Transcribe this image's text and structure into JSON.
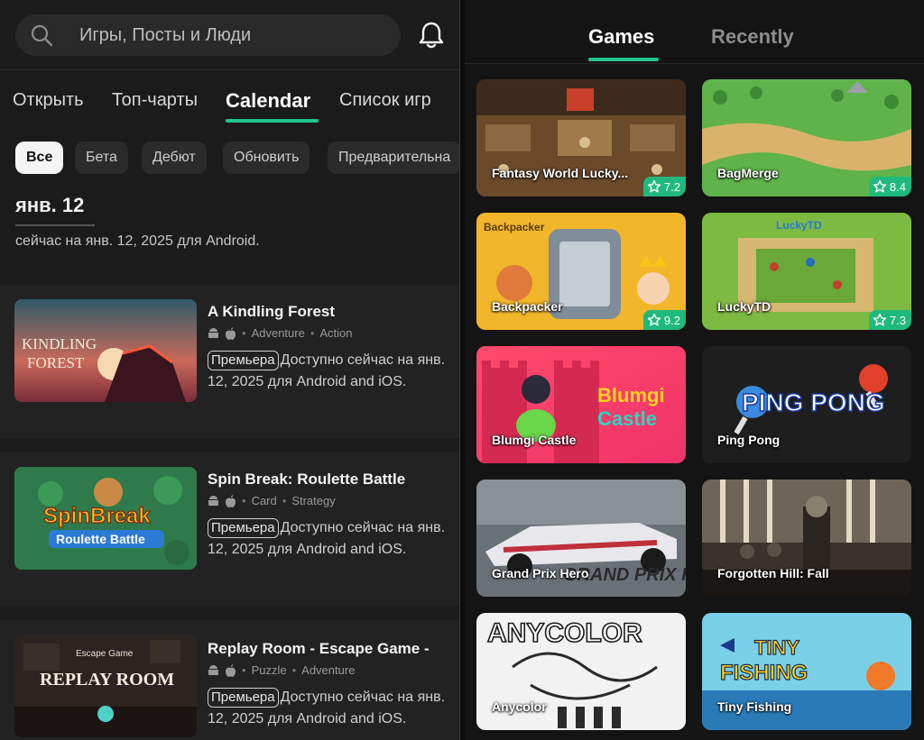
{
  "search": {
    "placeholder": "Игры, Посты и Люди"
  },
  "tabs": [
    {
      "label": "Открыть"
    },
    {
      "label": "Топ-чарты"
    },
    {
      "label": "Calendar"
    },
    {
      "label": "Список игр"
    }
  ],
  "chips": [
    {
      "label": "Все"
    },
    {
      "label": "Бета"
    },
    {
      "label": "Дебют"
    },
    {
      "label": "Обновить"
    },
    {
      "label": "Предварительна"
    }
  ],
  "date": {
    "heading": "янв. 12",
    "subtitle": "сейчас на янв. 12, 2025 для Android."
  },
  "cards": [
    {
      "title": "A Kindling Forest",
      "genres": [
        "Adventure",
        "Action"
      ],
      "badge": "Премьера",
      "desc_lead": "Доступно сейчас на",
      "desc_rest": "янв. 12, 2025 для Android and iOS.",
      "thumb_text": "A KINDLING FOREST"
    },
    {
      "title": "Spin Break: Roulette Battle",
      "genres": [
        "Card",
        "Strategy"
      ],
      "badge": "Премьера",
      "desc_lead": "Доступно сейчас на",
      "desc_rest": "янв. 12, 2025 для Android and iOS.",
      "thumb_text": "SpinBreak",
      "thumb_text2": "Roulette Battle"
    },
    {
      "title": "Replay Room - Escape Game -",
      "genres": [
        "Puzzle",
        "Adventure"
      ],
      "badge": "Премьера",
      "desc_lead": "Доступно сейчас на",
      "desc_rest": "янв. 12, 2025 для Android and iOS.",
      "thumb_text": "REPLAY ROOM",
      "thumb_text2": "Escape Game"
    }
  ],
  "right_tabs": [
    {
      "label": "Games"
    },
    {
      "label": "Recently"
    }
  ],
  "games": [
    {
      "name": "Fantasy World Lucky...",
      "rating": "7.2"
    },
    {
      "name": "BagMerge",
      "rating": "8.4"
    },
    {
      "name": "Backpacker",
      "rating": "9.2",
      "art_text": "Backpacker"
    },
    {
      "name": "LuckyTD",
      "rating": "7.3",
      "art_text": "LuckyTD"
    },
    {
      "name": "Blumgi Castle",
      "art_text": "Blumgi",
      "art_text2": "Castle"
    },
    {
      "name": "Ping Pong",
      "art_text": "PING PONG"
    },
    {
      "name": "Grand Prix Hero",
      "art_text": "GRAND PRIX HERO"
    },
    {
      "name": "Forgotten Hill: Fall"
    },
    {
      "name": "Anycolor",
      "art_text": "ANYCOLOR"
    },
    {
      "name": "Tiny Fishing",
      "art_text": "TINY",
      "art_text2": "FISHING"
    }
  ],
  "colors": {
    "accent": "#21c48a",
    "rating_bg": "#1fb97e"
  }
}
